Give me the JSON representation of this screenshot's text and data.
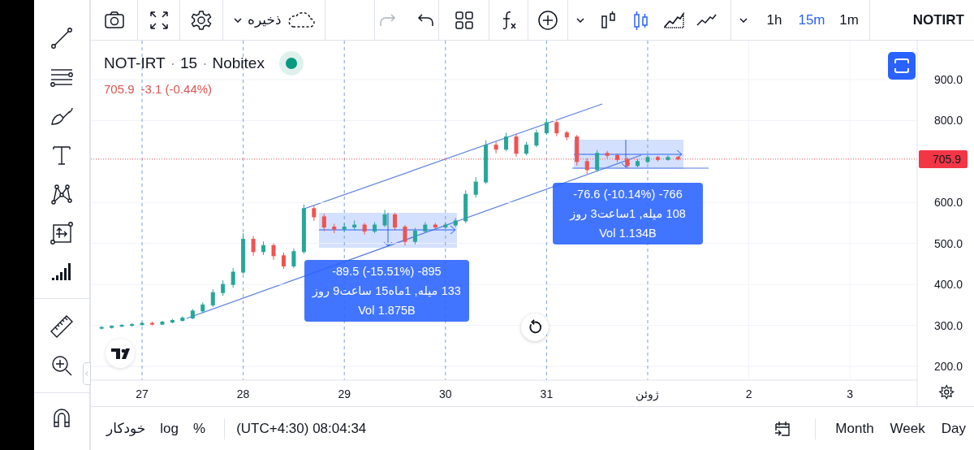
{
  "toolbar": {
    "save_label": "ذخیره",
    "history": [
      {
        "kind": "redo",
        "disabled": true
      },
      {
        "kind": "undo",
        "disabled": false
      }
    ],
    "chart_types": [
      {
        "kind": "bars",
        "selected": false
      },
      {
        "kind": "candles",
        "selected": true
      },
      {
        "kind": "area",
        "selected": false
      },
      {
        "kind": "line",
        "selected": false
      }
    ],
    "intervals": [
      {
        "label": "1h",
        "selected": false
      },
      {
        "label": "15m",
        "selected": true
      },
      {
        "label": "1m",
        "selected": false
      }
    ],
    "symbol": "NOTIRT"
  },
  "legend": {
    "title": [
      {
        "kind": "symbol",
        "text": "NOT-IRT"
      },
      {
        "kind": "separator",
        "text": "·"
      },
      {
        "kind": "interval",
        "text": "15"
      },
      {
        "kind": "separator",
        "text": "·"
      },
      {
        "kind": "exchange",
        "text": "Nobitex"
      }
    ],
    "price": "705.9",
    "change": "-3.1 (-0.44%)"
  },
  "chart": {
    "chart_data": {
      "type": "candlestick",
      "xlim": [
        26.494,
        34.665
      ],
      "ylim": [
        166.3,
        995.2
      ],
      "x": [
        26.6,
        26.7,
        26.8,
        26.9,
        27.0,
        27.1,
        27.2,
        27.3,
        27.4,
        27.5,
        27.6,
        27.7,
        27.8,
        27.9,
        28.0,
        28.1,
        28.2,
        28.3,
        28.4,
        28.5,
        28.6,
        28.7,
        28.8,
        28.9,
        29.0,
        29.1,
        29.2,
        29.3,
        29.4,
        29.5,
        29.6,
        29.7,
        29.8,
        29.9,
        30.0,
        30.1,
        30.2,
        30.3,
        30.4,
        30.5,
        30.6,
        30.7,
        30.8,
        30.9,
        31.0,
        31.1,
        31.2,
        31.3,
        31.4,
        31.5,
        31.6,
        31.7,
        31.8,
        31.9,
        32.0,
        32.1,
        32.2,
        32.3
      ],
      "ohlc": [
        [
          293,
          298,
          290,
          295
        ],
        [
          295,
          300,
          292,
          298
        ],
        [
          298,
          303,
          296,
          300
        ],
        [
          300,
          305,
          297,
          302
        ],
        [
          302,
          308,
          299,
          305
        ],
        [
          305,
          309,
          300,
          303
        ],
        [
          303,
          311,
          301,
          308
        ],
        [
          308,
          316,
          305,
          312
        ],
        [
          312,
          322,
          309,
          318
        ],
        [
          318,
          340,
          315,
          335
        ],
        [
          335,
          356,
          330,
          350
        ],
        [
          350,
          388,
          345,
          380
        ],
        [
          380,
          410,
          372,
          400
        ],
        [
          400,
          440,
          392,
          430
        ],
        [
          430,
          525,
          425,
          510
        ],
        [
          510,
          518,
          470,
          480
        ],
        [
          480,
          505,
          472,
          495
        ],
        [
          495,
          500,
          460,
          470
        ],
        [
          470,
          478,
          438,
          445
        ],
        [
          445,
          488,
          440,
          480
        ],
        [
          480,
          595,
          475,
          585
        ],
        [
          585,
          592,
          555,
          565
        ],
        [
          565,
          572,
          530,
          540
        ],
        [
          540,
          548,
          525,
          535
        ],
        [
          535,
          550,
          528,
          540
        ],
        [
          540,
          556,
          532,
          545
        ],
        [
          545,
          550,
          522,
          530
        ],
        [
          530,
          552,
          525,
          545
        ],
        [
          545,
          582,
          540,
          570
        ],
        [
          570,
          575,
          532,
          540
        ],
        [
          540,
          545,
          495,
          505
        ],
        [
          505,
          538,
          498,
          530
        ],
        [
          530,
          552,
          525,
          545
        ],
        [
          545,
          550,
          533,
          540
        ],
        [
          540,
          552,
          535,
          545
        ],
        [
          545,
          562,
          540,
          555
        ],
        [
          555,
          630,
          550,
          620
        ],
        [
          620,
          662,
          612,
          650
        ],
        [
          650,
          752,
          645,
          740
        ],
        [
          740,
          748,
          720,
          730
        ],
        [
          730,
          770,
          725,
          760
        ],
        [
          760,
          768,
          712,
          720
        ],
        [
          720,
          748,
          715,
          740
        ],
        [
          740,
          778,
          735,
          770
        ],
        [
          770,
          805,
          765,
          795
        ],
        [
          795,
          800,
          762,
          770
        ],
        [
          770,
          775,
          752,
          760
        ],
        [
          760,
          765,
          690,
          700
        ],
        [
          700,
          708,
          670,
          680
        ],
        [
          680,
          728,
          675,
          720
        ],
        [
          720,
          726,
          708,
          715
        ],
        [
          715,
          720,
          698,
          705
        ],
        [
          705,
          710,
          682,
          690
        ],
        [
          690,
          706,
          686,
          700
        ],
        [
          700,
          716,
          696,
          710
        ],
        [
          710,
          714,
          700,
          705
        ],
        [
          705,
          715,
          702,
          710
        ],
        [
          710,
          713,
          703,
          706
        ]
      ],
      "xticks": [
        {
          "value": 27,
          "label": "27"
        },
        {
          "value": 28,
          "label": "28"
        },
        {
          "value": 29,
          "label": "29"
        },
        {
          "value": 30,
          "label": "30"
        },
        {
          "value": 31,
          "label": "31"
        },
        {
          "value": 32,
          "label": "ژوئن"
        }
      ],
      "yticks": [
        {
          "value": 200,
          "label": "200.0"
        },
        {
          "value": 300,
          "label": "300.0"
        },
        {
          "value": 400,
          "label": "400.0"
        },
        {
          "value": 500,
          "label": "500.0"
        },
        {
          "value": 600,
          "label": "600.0"
        },
        {
          "value": 800,
          "label": "800.0"
        },
        {
          "value": 900,
          "label": "900.0"
        }
      ],
      "ref_lines": [
        {
          "axis": "y",
          "value": 705.9,
          "label": "705.9"
        }
      ],
      "grid": true
    },
    "next_month_days": [
      "2",
      "3"
    ],
    "measurements": [
      {
        "lines": [
          "-89.5 (-15.51%) -895",
          "روز ساعت9 1ماه15 میله, 133",
          "Vol 1.875B"
        ]
      },
      {
        "lines": [
          "-76.6 (-10.14%) -766",
          "روز 1ساعت3 میله, 108",
          "Vol 1.134B"
        ]
      }
    ]
  },
  "bottom_bar": {
    "scale_modes": [
      "خودکار",
      "log",
      "%"
    ],
    "time": "(UTC+4:30) 08:04:34",
    "ranges": [
      "Month",
      "Week",
      "Day"
    ]
  }
}
